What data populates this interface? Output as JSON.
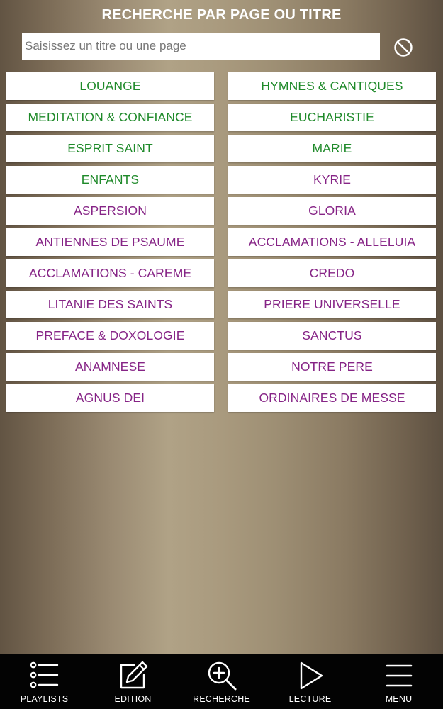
{
  "header": {
    "title": "RECHERCHE PAR PAGE OU TITRE"
  },
  "search": {
    "placeholder": "Saisissez un titre ou une page",
    "value": ""
  },
  "categories": [
    {
      "label": "LOUANGE",
      "color": "#1f8a2a"
    },
    {
      "label": "HYMNES & CANTIQUES",
      "color": "#1f8a2a"
    },
    {
      "label": "MEDITATION & CONFIANCE",
      "color": "#1f8a2a"
    },
    {
      "label": "EUCHARISTIE",
      "color": "#1f8a2a"
    },
    {
      "label": "ESPRIT SAINT",
      "color": "#1f8a2a"
    },
    {
      "label": "MARIE",
      "color": "#1f8a2a"
    },
    {
      "label": "ENFANTS",
      "color": "#1f8a2a"
    },
    {
      "label": "KYRIE",
      "color": "#862486"
    },
    {
      "label": "ASPERSION",
      "color": "#862486"
    },
    {
      "label": "GLORIA",
      "color": "#862486"
    },
    {
      "label": "ANTIENNES DE PSAUME",
      "color": "#862486"
    },
    {
      "label": "ACCLAMATIONS - ALLELUIA",
      "color": "#862486"
    },
    {
      "label": "ACCLAMATIONS - CAREME",
      "color": "#862486"
    },
    {
      "label": "CREDO",
      "color": "#862486"
    },
    {
      "label": "LITANIE DES SAINTS",
      "color": "#862486"
    },
    {
      "label": "PRIERE UNIVERSELLE",
      "color": "#862486"
    },
    {
      "label": "PREFACE & DOXOLOGIE",
      "color": "#862486"
    },
    {
      "label": "SANCTUS",
      "color": "#862486"
    },
    {
      "label": "ANAMNESE",
      "color": "#862486"
    },
    {
      "label": "NOTRE PERE",
      "color": "#862486"
    },
    {
      "label": "AGNUS DEI",
      "color": "#862486"
    },
    {
      "label": "ORDINAIRES DE MESSE",
      "color": "#862486"
    }
  ],
  "bottom_nav": [
    {
      "label": "PLAYLISTS",
      "icon": "list-icon"
    },
    {
      "label": "EDITION",
      "icon": "edit-icon"
    },
    {
      "label": "RECHERCHE",
      "icon": "zoom-in-icon"
    },
    {
      "label": "LECTURE",
      "icon": "play-icon"
    },
    {
      "label": "MENU",
      "icon": "hamburger-menu-icon"
    }
  ]
}
